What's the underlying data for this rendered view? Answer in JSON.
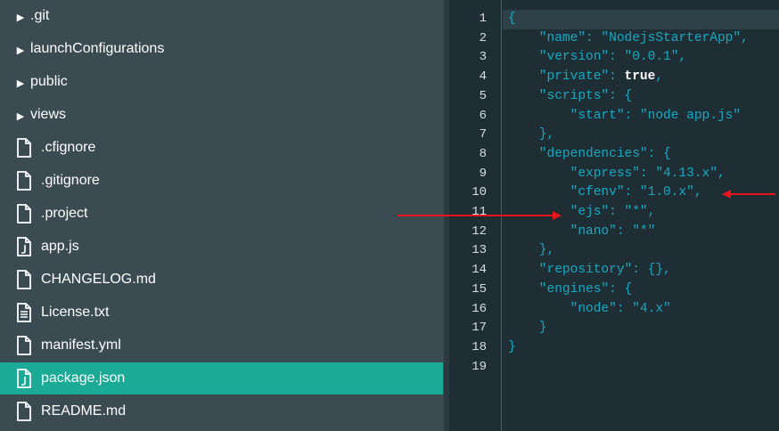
{
  "sidebar": {
    "items": [
      {
        "type": "folder",
        "label": ".git"
      },
      {
        "type": "folder",
        "label": "launchConfigurations"
      },
      {
        "type": "folder",
        "label": "public"
      },
      {
        "type": "folder",
        "label": "views"
      },
      {
        "type": "file",
        "icon": "file-icon",
        "label": ".cfignore"
      },
      {
        "type": "file",
        "icon": "file-icon",
        "label": ".gitignore"
      },
      {
        "type": "file",
        "icon": "file-icon",
        "label": ".project"
      },
      {
        "type": "file",
        "icon": "js-file-icon",
        "label": "app.js"
      },
      {
        "type": "file",
        "icon": "file-icon",
        "label": "CHANGELOG.md"
      },
      {
        "type": "file",
        "icon": "text-file-icon",
        "label": "License.txt"
      },
      {
        "type": "file",
        "icon": "file-icon",
        "label": "manifest.yml"
      },
      {
        "type": "file",
        "icon": "js-file-icon",
        "label": "package.json",
        "selected": true
      },
      {
        "type": "file",
        "icon": "file-icon",
        "label": "README.md"
      }
    ]
  },
  "editor": {
    "lines": [
      "{",
      "    \"name\": \"NodejsStarterApp\",",
      "    \"version\": \"0.0.1\",",
      "    \"private\": true,",
      "    \"scripts\": {",
      "        \"start\": \"node app.js\"",
      "    },",
      "    \"dependencies\": {",
      "        \"express\": \"4.13.x\",",
      "        \"cfenv\": \"1.0.x\",",
      "        \"ejs\": \"*\",",
      "        \"nano\": \"*\"",
      "    },",
      "    \"repository\": {},",
      "    \"engines\": {",
      "        \"node\": \"4.x\"",
      "    }",
      "}",
      ""
    ],
    "line_numbers": [
      "1",
      "2",
      "3",
      "4",
      "5",
      "6",
      "7",
      "8",
      "9",
      "10",
      "11",
      "12",
      "13",
      "14",
      "15",
      "16",
      "17",
      "18",
      "19"
    ],
    "current_line": 1
  },
  "colors": {
    "sidebar_bg": "#3b4b52",
    "selected_bg": "#1aaa96",
    "editor_bg": "#1f2e34",
    "code_text": "#15a9c2",
    "annotation_arrow": "#e8141b"
  }
}
